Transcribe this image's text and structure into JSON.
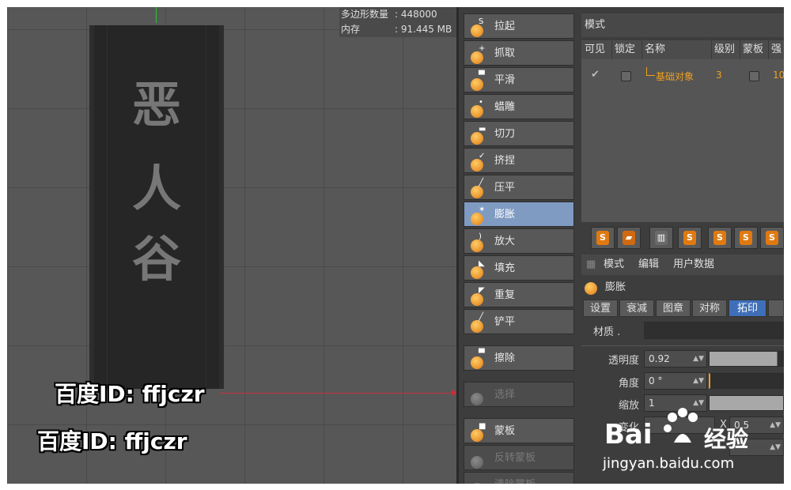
{
  "viewport": {
    "plaque_chars": [
      "恶",
      "人",
      "谷"
    ],
    "stats": [
      {
        "label": "多边形数量",
        "value": ": 448000"
      },
      {
        "label": "内存",
        "value": ": 91.445 MB"
      }
    ],
    "watermarks": [
      "百度ID: ffjczr",
      "百度ID: ffjczr"
    ]
  },
  "tools": {
    "items": [
      {
        "label": "拉起",
        "state": "normal"
      },
      {
        "label": "抓取",
        "state": "normal"
      },
      {
        "label": "平滑",
        "state": "normal"
      },
      {
        "label": "蜡雕",
        "state": "normal"
      },
      {
        "label": "切刀",
        "state": "normal"
      },
      {
        "label": "挤捏",
        "state": "normal"
      },
      {
        "label": "压平",
        "state": "normal"
      },
      {
        "label": "膨胀",
        "state": "selected"
      },
      {
        "label": "放大",
        "state": "normal"
      },
      {
        "label": "填充",
        "state": "normal"
      },
      {
        "label": "重复",
        "state": "normal"
      },
      {
        "label": "铲平",
        "state": "normal"
      },
      {
        "label": "擦除",
        "state": "normal"
      },
      {
        "label": "选择",
        "state": "disabled"
      },
      {
        "label": "蒙板",
        "state": "normal"
      },
      {
        "label": "反转蒙板",
        "state": "disabled"
      },
      {
        "label": "清除蒙板",
        "state": "disabled"
      }
    ]
  },
  "layers": {
    "mode_title": "模式",
    "columns": [
      "可见",
      "锁定",
      "名称",
      "级别",
      "蒙板",
      "强"
    ],
    "row": {
      "name": "基础对象",
      "level": "3",
      "strength": "10"
    }
  },
  "attributes": {
    "tabs": [
      "模式",
      "编辑",
      "用户数据"
    ],
    "object_name": "膨胀",
    "subtabs": [
      "设置",
      "衰减",
      "图章",
      "对称",
      "拓印"
    ],
    "active_subtab": "拓印",
    "material_label": "材质",
    "props": [
      {
        "label": "透明度",
        "value": "0.92",
        "fill": 0.92
      },
      {
        "label": "角度",
        "value": "0 °",
        "fill": 0.0
      },
      {
        "label": "缩放",
        "value": "1",
        "fill": 1.0
      }
    ],
    "transform_label": "变化",
    "x_label": "X",
    "x_value": "0.5"
  },
  "branding": {
    "logo_left": "Bai",
    "logo_right": "经验",
    "url": "jingyan.baidu.com"
  },
  "colors": {
    "accent_orange": "#e07a10",
    "selected_blue": "#7f9bc2",
    "tab_active": "#3f6fb8"
  }
}
